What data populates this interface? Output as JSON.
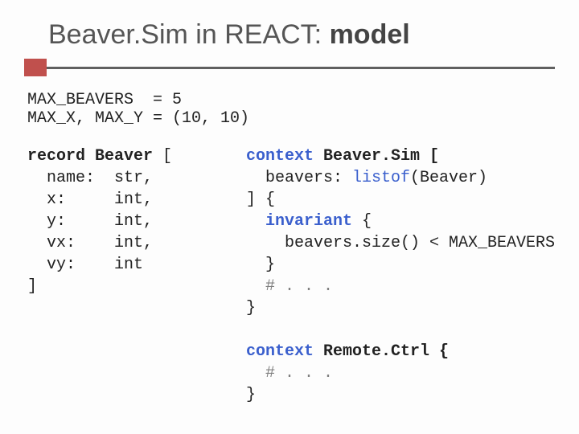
{
  "title": {
    "prefix": "Beaver.Sim in REACT: ",
    "bold": "model"
  },
  "constants": "MAX_BEAVERS  = 5\nMAX_X, MAX_Y = (10, 10)",
  "left": {
    "kw_record": "record",
    "name": "Beaver",
    "open": " [",
    "fields": "  name:  str,\n  x:     int,\n  y:     int,\n  vx:    int,\n  vy:    int",
    "close": "]"
  },
  "right": {
    "ctx1_kw": "context",
    "ctx1_open": " Beaver.Sim [",
    "ctx1_field_key": "  beavers: ",
    "ctx1_listof": "listof",
    "ctx1_listof_arg": "(Beaver)",
    "ctx1_head_close": "] {",
    "invariant_kw": "invariant",
    "invariant_open": " {",
    "invariant_body": "    beavers.size() < MAX_BEAVERS",
    "invariant_close": "  }",
    "ctx1_ellipsis_hash": "  # ",
    "ctx1_ellipsis_dots": ". . .",
    "ctx1_close": "}",
    "ctx2_kw": "context",
    "ctx2_open": " Remote.Ctrl {",
    "ctx2_ellipsis_hash": "  # ",
    "ctx2_ellipsis_dots": ". . .",
    "ctx2_close": "}"
  }
}
